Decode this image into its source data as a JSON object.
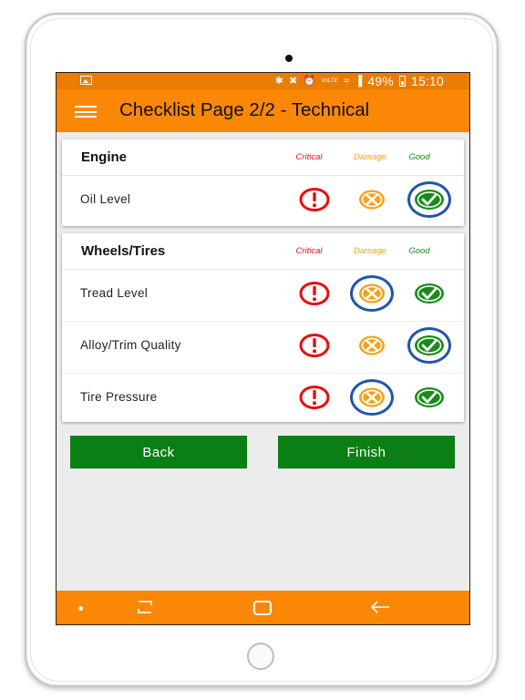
{
  "status_bar": {
    "battery_percent": "49%",
    "time": "15:10",
    "network_label": "VoLTE"
  },
  "app_bar": {
    "title": "Checklist Page 2/2 - Technical"
  },
  "columns": {
    "critical": "Critical",
    "damage": "Damage",
    "good": "Good"
  },
  "colors": {
    "accent": "#fb8706",
    "critical": "#e31010",
    "damage": "#f5a21b",
    "good": "#1b8a1b",
    "selected_ring": "#2156a8",
    "button": "#0b7f16"
  },
  "sections": [
    {
      "title": "Engine",
      "items": [
        {
          "label": "Oil Level",
          "selected": "good"
        }
      ]
    },
    {
      "title": "Wheels/Tires",
      "items": [
        {
          "label": "Tread Level",
          "selected": "damage"
        },
        {
          "label": "Alloy/Trim Quality",
          "selected": "good"
        },
        {
          "label": "Tire Pressure",
          "selected": "damage"
        }
      ]
    }
  ],
  "buttons": {
    "back": "Back",
    "finish": "Finish"
  }
}
